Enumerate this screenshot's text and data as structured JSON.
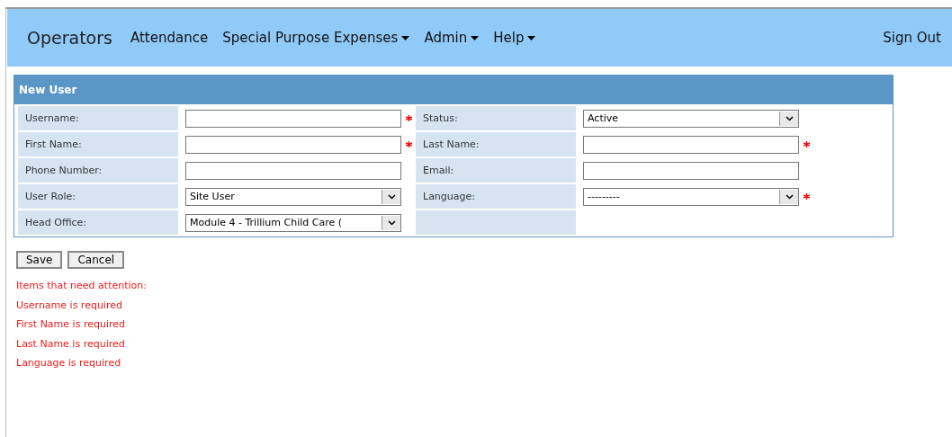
{
  "navbar": {
    "brand": "Operators",
    "items": [
      {
        "label": "Attendance",
        "dropdown": false
      },
      {
        "label": "Special Purpose Expenses",
        "dropdown": true
      },
      {
        "label": "Admin",
        "dropdown": true
      },
      {
        "label": "Help",
        "dropdown": true
      }
    ],
    "sign_out": "Sign Out"
  },
  "panel": {
    "title": "New User",
    "rows": [
      [
        {
          "label": "Username:",
          "kind": "text",
          "required": true
        },
        {
          "label": "Status:",
          "kind": "select",
          "value": "Active",
          "required": false
        }
      ],
      [
        {
          "label": "First Name:",
          "kind": "text",
          "required": true
        },
        {
          "label": "Last Name:",
          "kind": "text",
          "required": true
        }
      ],
      [
        {
          "label": "Phone Number:",
          "kind": "text",
          "required": false
        },
        {
          "label": "Email:",
          "kind": "text",
          "required": false
        }
      ],
      [
        {
          "label": "User Role:",
          "kind": "select",
          "value": "Site User",
          "required": false
        },
        {
          "label": "Language:",
          "kind": "select",
          "value": "---------",
          "required": true
        }
      ],
      [
        {
          "label": "Head Office:",
          "kind": "select",
          "value": "Module 4 - Trillium Child Care (",
          "required": false
        },
        {
          "kind": "empty"
        }
      ]
    ]
  },
  "buttons": [
    "Save",
    "Cancel"
  ],
  "errors": {
    "title": "Items that need attention:",
    "items": [
      "Username is required",
      "First Name is required",
      "Last Name is required",
      "Language is required"
    ]
  }
}
